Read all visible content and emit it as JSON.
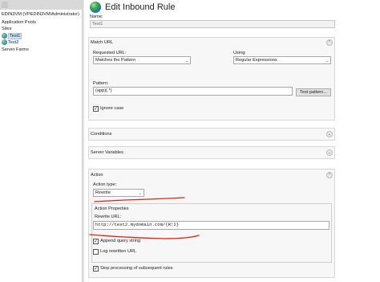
{
  "tree": {
    "server": "EDIN3VM (VPEDIN3VM\\Administrator)",
    "app_pools": "Application Pools",
    "sites": "Sites",
    "site1": "Test1",
    "site2": "Test2",
    "server_farms": "Server Farms"
  },
  "header": {
    "title": "Edit Inbound Rule"
  },
  "name": {
    "label": "Name:",
    "value": "Test1"
  },
  "match_url": {
    "title": "Match URL",
    "requested_label": "Requested URL:",
    "requested_value": "Matches the Pattern",
    "using_label": "Using:",
    "using_value": "Regular Expressions",
    "pattern_label": "Pattern:",
    "pattern_value": "(app)(.*)",
    "test_button": "Test pattern...",
    "ignore_case": "Ignore case"
  },
  "sections": {
    "conditions": "Conditions",
    "server_variables": "Server Variables"
  },
  "action": {
    "title": "Action",
    "type_label": "Action type:",
    "type_value": "Rewrite",
    "properties_title": "Action Properties",
    "rewrite_label": "Rewrite URL:",
    "rewrite_value": "http://test2.mydomain.com/{R:2}",
    "append_query": "Append query string",
    "log_rewritten": "Log rewritten URL",
    "stop_processing": "Stop processing of subsequent rules"
  },
  "annotation_color": "#e0241b"
}
